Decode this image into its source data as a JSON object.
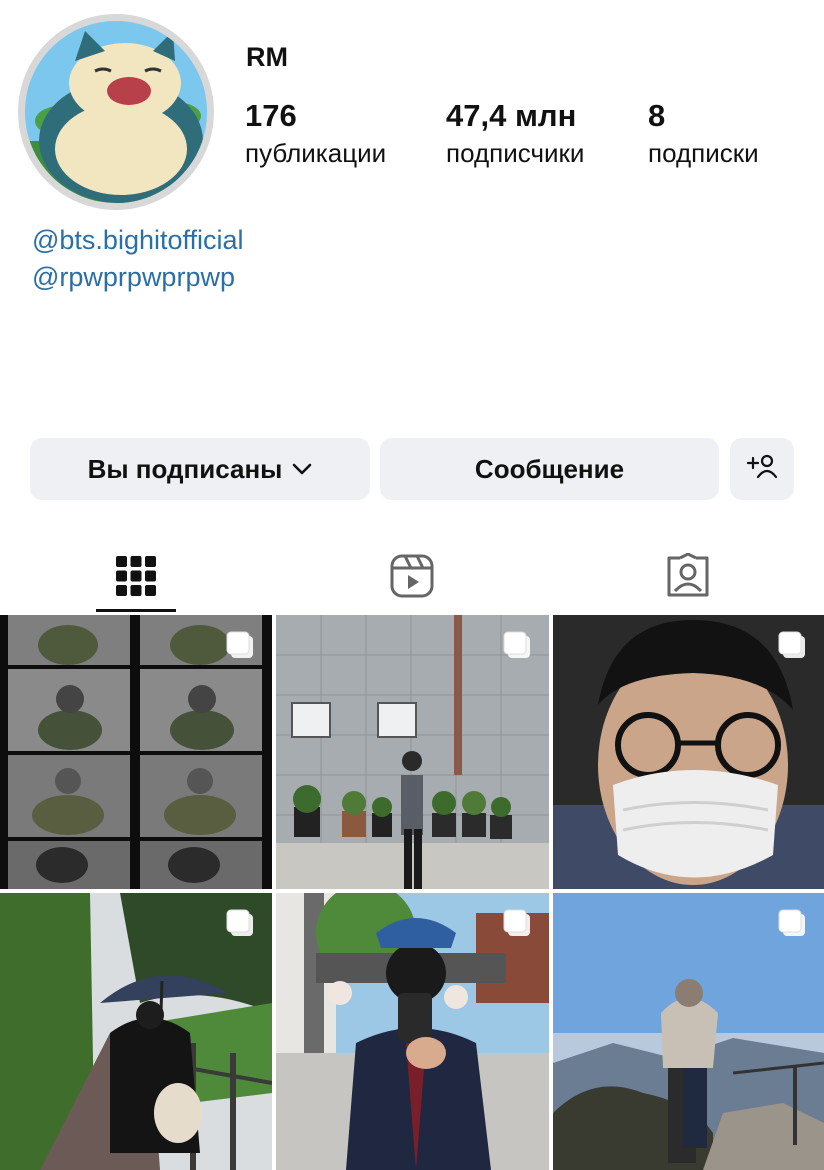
{
  "profile": {
    "username": "RM",
    "posts_count": "176",
    "posts_label": "публикации",
    "followers_count": "47,4 млн",
    "followers_label": "подписчики",
    "following_count": "8",
    "following_label": "подписки",
    "links": [
      "@bts.bighitofficial",
      "@rpwprpwprpwp"
    ]
  },
  "actions": {
    "following_label": "Вы подписаны",
    "message_label": "Сообщение"
  },
  "tabs": [
    {
      "name": "grid",
      "icon": "grid-icon",
      "active": true
    },
    {
      "name": "reels",
      "icon": "reels-icon",
      "active": false
    },
    {
      "name": "tagged",
      "icon": "tagged-icon",
      "active": false
    }
  ],
  "posts": [
    {
      "icon": "multi-photo-icon"
    },
    {
      "icon": "multi-photo-icon"
    },
    {
      "icon": "multi-photo-icon"
    },
    {
      "icon": "multi-photo-icon"
    },
    {
      "icon": "multi-photo-icon"
    },
    {
      "icon": "multi-photo-icon"
    }
  ],
  "colors": {
    "link": "#2a6fa8",
    "button_bg": "#eef0f3",
    "text": "#111111"
  }
}
